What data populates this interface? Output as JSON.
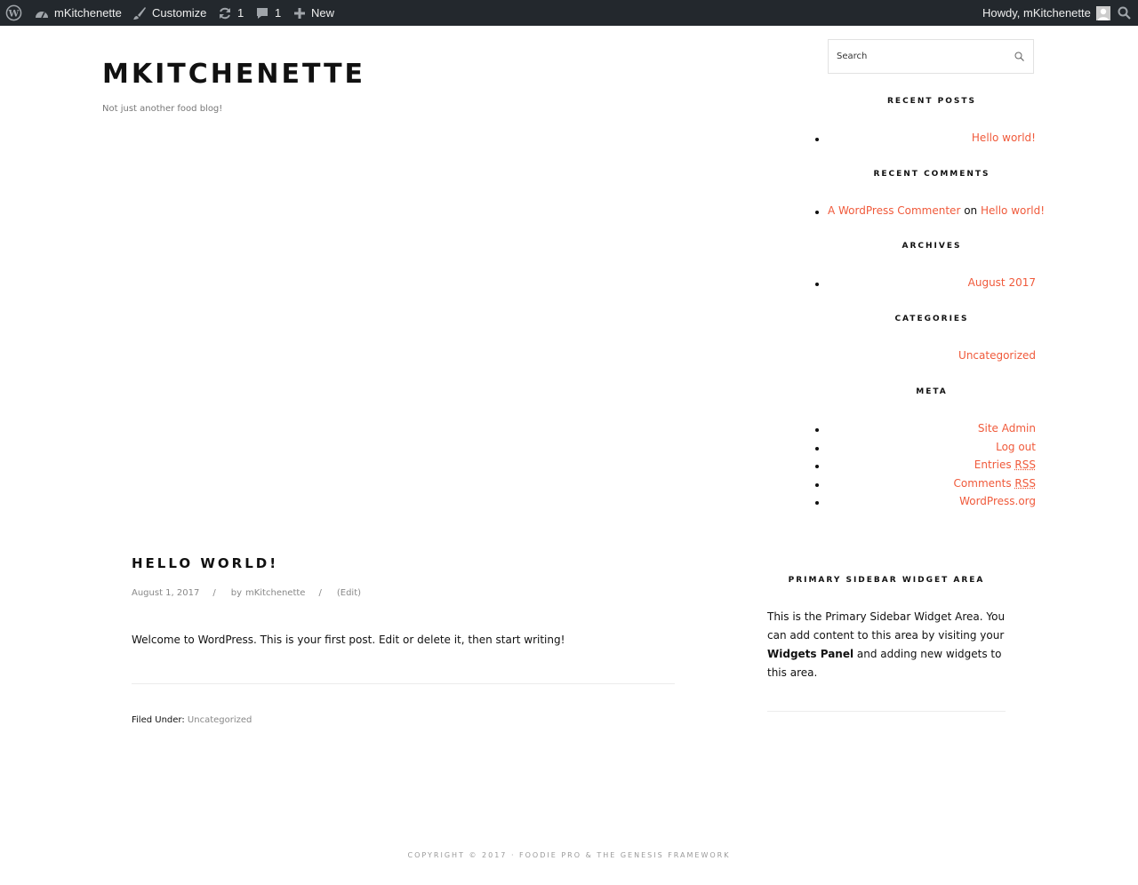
{
  "admin_bar": {
    "site_name": "mKitchenette",
    "customize": "Customize",
    "updates_count": "1",
    "comments_count": "1",
    "new_label": "New",
    "howdy": "Howdy, mKitchenette",
    "bg_color": "#23282d"
  },
  "header": {
    "title": "MKITCHENETTE",
    "description": "Not just another food blog!"
  },
  "search": {
    "placeholder": "Search"
  },
  "sidebar": {
    "recent_posts": {
      "title": "RECENT POSTS",
      "items": [
        "Hello world!"
      ]
    },
    "recent_comments": {
      "title": "RECENT COMMENTS",
      "author": "A WordPress Commenter",
      "on": "on",
      "post": "Hello world!"
    },
    "archives": {
      "title": "ARCHIVES",
      "items": [
        "August 2017"
      ]
    },
    "categories": {
      "title": "CATEGORIES",
      "items": [
        "Uncategorized"
      ]
    },
    "meta": {
      "title": "META",
      "site_admin": "Site Admin",
      "log_out": "Log out",
      "entries_prefix": "Entries",
      "comments_prefix": "Comments",
      "rss": "RSS",
      "wordpress_org": "WordPress.org"
    }
  },
  "post": {
    "title": "HELLO WORLD!",
    "date": "August 1, 2017",
    "sep": "/",
    "by": "by",
    "author": "mKitchenette",
    "edit": "(Edit)",
    "content": "Welcome to WordPress. This is your first post. Edit or delete it, then start writing!",
    "filed_under": "Filed Under:",
    "category": "Uncategorized"
  },
  "primary_sidebar": {
    "title": "PRIMARY SIDEBAR WIDGET AREA",
    "text_before": "This is the Primary Sidebar Widget Area. You can add content to this area by visiting your ",
    "text_bold": "Widgets Panel",
    "text_after": " and adding new widgets to this area."
  },
  "footer": {
    "text": "COPYRIGHT © 2017 · FOODIE PRO & THE GENESIS FRAMEWORK"
  },
  "colors": {
    "link": "#f05a3b",
    "text": "#111111",
    "muted": "#888888"
  }
}
